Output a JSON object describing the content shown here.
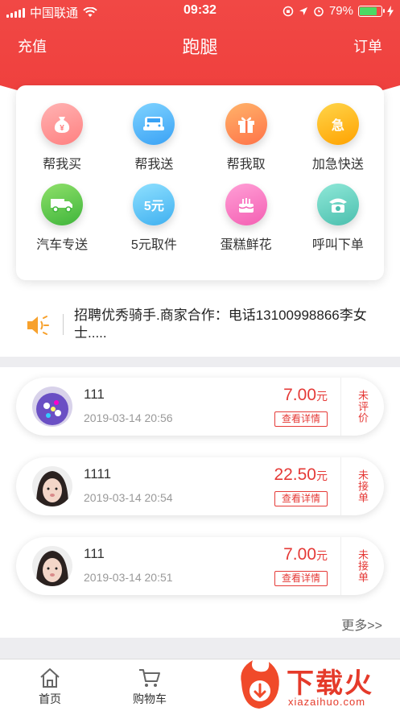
{
  "status_bar": {
    "carrier": "中国联通",
    "time": "09:32",
    "battery": "79%"
  },
  "nav": {
    "left": "充值",
    "title": "跑腿",
    "right": "订单"
  },
  "services": [
    {
      "label": "帮我买",
      "icon": "money-bag-icon",
      "glyph": "¥",
      "color_from": "#ffb3b3",
      "color_to": "#ff8080"
    },
    {
      "label": "帮我送",
      "icon": "car-icon",
      "glyph": "",
      "color_from": "#7fd3ff",
      "color_to": "#3aa2f5"
    },
    {
      "label": "帮我取",
      "icon": "gift-icon",
      "glyph": "",
      "color_from": "#ffb36a",
      "color_to": "#ff7348"
    },
    {
      "label": "加急快送",
      "icon": "urgent-icon",
      "glyph": "急",
      "color_from": "#ffd54a",
      "color_to": "#ffa200"
    },
    {
      "label": "汽车专送",
      "icon": "truck-icon",
      "glyph": "",
      "color_from": "#8fe06a",
      "color_to": "#3fb53b"
    },
    {
      "label": "5元取件",
      "icon": "five-yuan-icon",
      "glyph": "5元",
      "color_from": "#8fe0ff",
      "color_to": "#3fb0f0"
    },
    {
      "label": "蛋糕鲜花",
      "icon": "cake-icon",
      "glyph": "",
      "color_from": "#ff9fd6",
      "color_to": "#f45fb3"
    },
    {
      "label": "呼叫下单",
      "icon": "phone-icon",
      "glyph": "",
      "color_from": "#8fe8d8",
      "color_to": "#4bbfae"
    }
  ],
  "notice": {
    "text": "招聘优秀骑手.商家合作：电话13100998866李女士....."
  },
  "orders": [
    {
      "id": "111",
      "time": "2019-03-14 20:56",
      "price": "7.00",
      "unit": "元",
      "detail": "查看详情",
      "status": "未评价"
    },
    {
      "id": "1111",
      "time": "2019-03-14 20:54",
      "price": "22.50",
      "unit": "元",
      "detail": "查看详情",
      "status": "未接单"
    },
    {
      "id": "111",
      "time": "2019-03-14 20:51",
      "price": "7.00",
      "unit": "元",
      "detail": "查看详情",
      "status": "未接单"
    }
  ],
  "more": "更多>>",
  "tabs": [
    {
      "label": "首页",
      "icon": "home-icon"
    },
    {
      "label": "购物车",
      "icon": "cart-icon"
    }
  ],
  "watermark": {
    "text": "下载火",
    "url": "xiazaihuo.com"
  },
  "colors": {
    "primary": "#ee3c3a",
    "price": "#e53a37"
  }
}
